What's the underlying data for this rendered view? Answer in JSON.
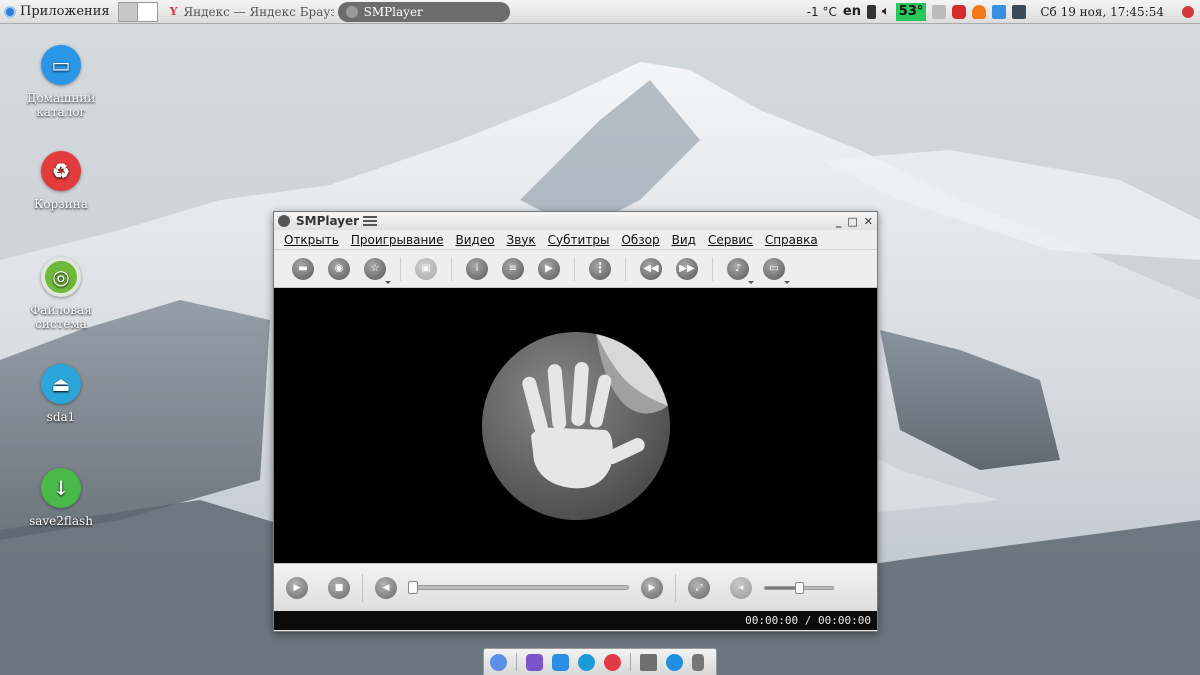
{
  "top_panel": {
    "apps_label": "Приложения",
    "tasks": [
      {
        "title": "Яндекс — Яндекс Брауз..."
      },
      {
        "title": "SMPlayer"
      }
    ],
    "tray": {
      "temperature": "-1 °C",
      "keyboard_layout": "en",
      "cpu_value": "53°",
      "clock": "Сб 19 ноя, 17:45:54"
    }
  },
  "desktop_icons": [
    {
      "label": "Домашний каталог",
      "icon": "home-folder-icon",
      "color": "#2a96e8"
    },
    {
      "label": "Корзина",
      "icon": "recycle-bin-icon",
      "color": "#e23b3b"
    },
    {
      "label": "Файловая система",
      "icon": "filesystem-icon",
      "color": "#6fb83a"
    },
    {
      "label": "sda1",
      "icon": "drive-eject-icon",
      "color": "#2aa7d8"
    },
    {
      "label": "save2flash",
      "icon": "download-icon",
      "color": "#4ab94a"
    }
  ],
  "window": {
    "title": "SMPlayer",
    "menu": [
      "Открыть",
      "Проигрывание",
      "Видео",
      "Звук",
      "Субтитры",
      "Обзор",
      "Вид",
      "Сервис",
      "Справка"
    ],
    "toolbar_icons": [
      "open-file-icon",
      "open-disc-icon",
      "favorites-icon",
      "screenshot-icon",
      "info-icon",
      "playlist-icon",
      "video-icon",
      "equalizer-icon",
      "previous-icon",
      "next-icon",
      "audio-track-icon",
      "subtitle-track-icon"
    ],
    "control_icons": [
      "play-icon",
      "stop-icon",
      "rewind-icon",
      "forward-icon",
      "fullscreen-icon",
      "mute-icon"
    ],
    "time_display": "00:00:00 / 00:00:00",
    "seek_position": 0,
    "volume_level": 0.5
  },
  "colors": {
    "panel_bg": "#e6e6e6",
    "video_bg": "#000000",
    "cpu_badge": "#29c75a"
  }
}
